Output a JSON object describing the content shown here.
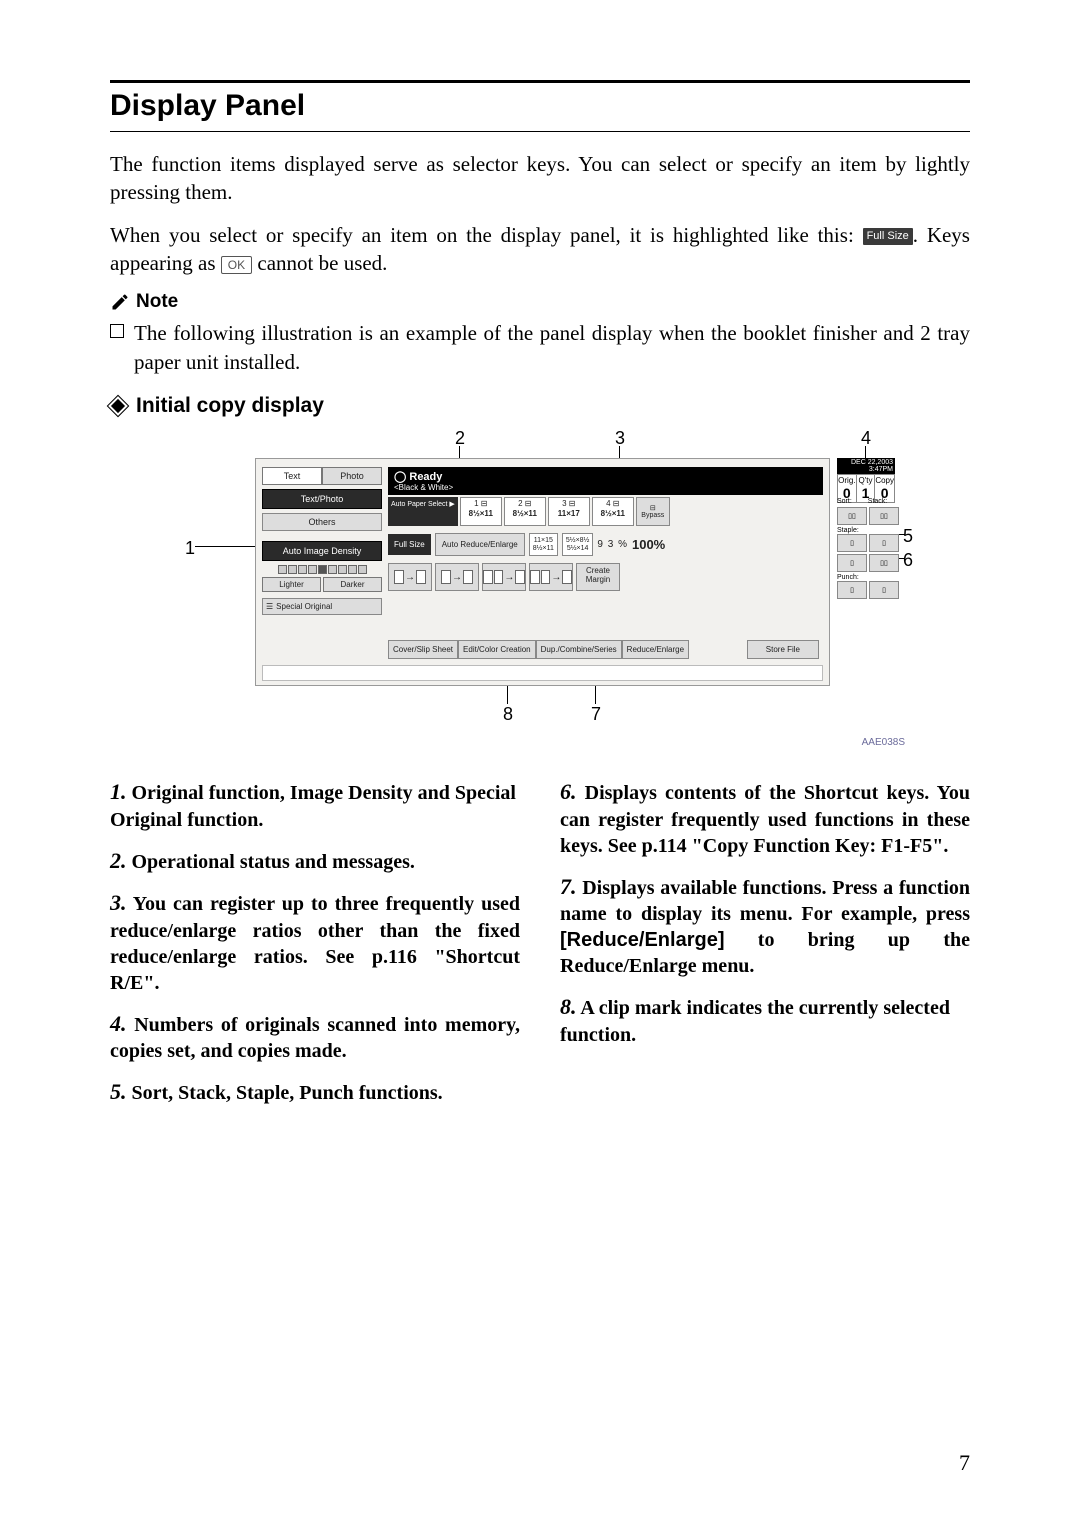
{
  "heading": "Display Panel",
  "intro1": "The function items displayed serve as selector keys. You can select or specify an item by lightly pressing them.",
  "intro2a": "When you select or specify an item on the display panel, it is highlighted like this: ",
  "intro2_btn1": "Full Size",
  "intro2b": ". Keys appearing as ",
  "intro2_btn2": "OK",
  "intro2c": " cannot be used.",
  "note_label": "Note",
  "note_item": "The following illustration is an example of the panel display when the booklet finisher and 2 tray paper unit installed.",
  "subhead": "Initial copy display",
  "callouts": {
    "c1": "1",
    "c2": "2",
    "c3": "3",
    "c4": "4",
    "c5": "5",
    "c6": "6",
    "c7": "7",
    "c8": "8"
  },
  "panel": {
    "tab_text": "Text",
    "tab_photo": "Photo",
    "text_photo": "Text/Photo",
    "others": "Others",
    "auto_density": "Auto Image Density",
    "lighter": "Lighter",
    "darker": "Darker",
    "special": "Special Original",
    "ready": "Ready",
    "ready_sub": "<Black & White>",
    "auto_paper": "Auto Paper Select",
    "tray1": "1",
    "size1": "8½×11",
    "tray2": "2",
    "size2": "8½×11",
    "tray3": "3",
    "size3": "11×17",
    "tray4": "4",
    "size4": "8½×11",
    "bypass": "Bypass",
    "full_size": "Full Size",
    "auto_re": "Auto Reduce/Enlarge",
    "s1a": "11×15",
    "s1b": "8½×11",
    "s2a": "5½×8½",
    "s2b": "5½×14",
    "ratio": "9 3 %",
    "pct": "100%",
    "create_margin": "Create Margin",
    "btab1": "Cover/Slip Sheet",
    "btab2": "Edit/Color Creation",
    "btab3": "Dup./Combine/Series",
    "btab4": "Reduce/Enlarge",
    "store_file": "Store File",
    "date": "DEC  22,2003  3:47PM",
    "orig": "Orig.",
    "qty": "Q'ty",
    "copy": "Copy",
    "n0a": "0",
    "n1": "1",
    "n0b": "0",
    "sort": "Sort:",
    "stack": "Stack:",
    "staple": "Staple:",
    "punch": "Punch:"
  },
  "fig_code": "AAE038S",
  "items": {
    "i1n": "1.",
    "i1": " Original function, Image Density and Special Original function.",
    "i2n": "2.",
    "i2": " Operational status and messages.",
    "i3n": "3.",
    "i3": " You can register up to three frequently used reduce/enlarge ratios other than the fixed reduce/enlarge ratios. See p.116 \"Shortcut R/E\".",
    "i4n": "4.",
    "i4": " Numbers of originals scanned into memory, copies set, and copies made.",
    "i5n": "5.",
    "i5": " Sort, Stack, Staple, Punch functions.",
    "i6n": "6.",
    "i6": " Displays contents of the Shortcut keys. You can register frequently used functions in these keys. See p.114 \"Copy Function Key: F1-F5\".",
    "i7n": "7.",
    "i7a": " Displays available functions. Press a function name to display its menu. For example, press ",
    "i7btn": "[Reduce/Enlarge]",
    "i7b": " to bring up the Reduce/Enlarge menu.",
    "i8n": "8.",
    "i8": " A clip mark indicates the currently selected function."
  },
  "page_number": "7"
}
